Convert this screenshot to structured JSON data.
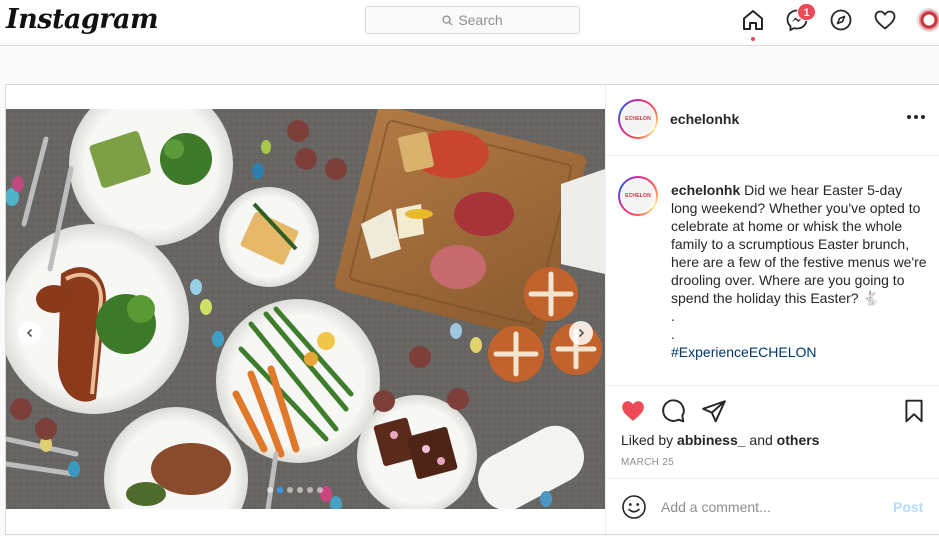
{
  "header": {
    "logo_text": "Instagram",
    "search_placeholder": "Search",
    "messages_badge": "1",
    "icons": [
      "home-icon",
      "messenger-icon",
      "explore-icon",
      "heart-icon",
      "profile-avatar"
    ]
  },
  "post": {
    "author": "echelonhk",
    "avatar_text": "ECHELON",
    "caption_user": "echelonhk",
    "caption_text": "Did we hear Easter 5-day long weekend? Whether you've opted to celebrate at home or whisk the whole family to a scrumptious Easter brunch, here are a few of the festive menus we're drooling over. Where are you going to spend the holiday this Easter? 🐇",
    "caption_dot1": ".",
    "caption_dot2": ".",
    "hashtag": "#ExperienceECHELON",
    "liked_by_prefix": "Liked by",
    "liked_by_user": "abbiness_",
    "liked_by_and": "and",
    "liked_by_others": "others",
    "date": "MARCH 25",
    "comment_placeholder": "Add a comment...",
    "post_button": "Post",
    "carousel_dots": 6,
    "carousel_active_index": 1
  },
  "colors": {
    "like_red": "#ed4956",
    "link_blue": "#00376b",
    "post_disabled": "#b3dbff"
  }
}
